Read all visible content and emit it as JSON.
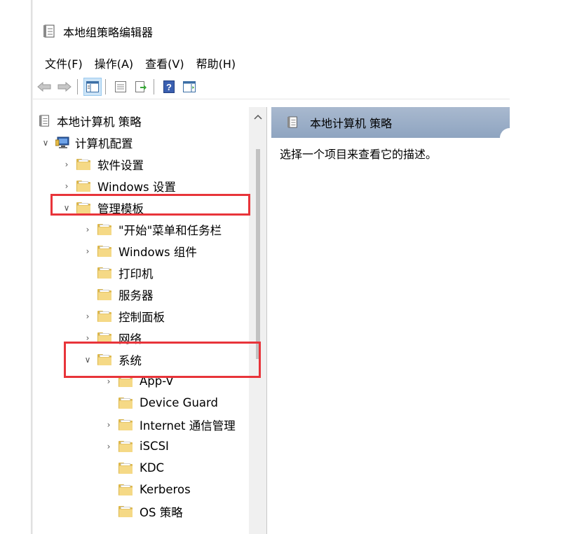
{
  "window": {
    "title": "本地组策略编辑器"
  },
  "menu": [
    "文件(F)",
    "操作(A)",
    "查看(V)",
    "帮助(H)"
  ],
  "tree": {
    "root": "本地计算机 策略",
    "computer_config": "计算机配置",
    "items": [
      {
        "label": "软件设置"
      },
      {
        "label": "Windows 设置"
      },
      {
        "label": "管理模板"
      },
      {
        "label": "\"开始\"菜单和任务栏"
      },
      {
        "label": "Windows 组件"
      },
      {
        "label": "打印机"
      },
      {
        "label": "服务器"
      },
      {
        "label": "控制面板"
      },
      {
        "label": "网络"
      },
      {
        "label": "系统"
      },
      {
        "label": "App-V"
      },
      {
        "label": "Device Guard"
      },
      {
        "label": "Internet 通信管理"
      },
      {
        "label": "iSCSI"
      },
      {
        "label": "KDC"
      },
      {
        "label": "Kerberos"
      },
      {
        "label": "OS 策略"
      }
    ]
  },
  "right_pane": {
    "header": "本地计算机 策略",
    "description": "选择一个项目来查看它的描述。"
  },
  "colors": {
    "highlight": "#e8343a",
    "header_bg": "#9aaec8",
    "folder": "#f5d986"
  }
}
